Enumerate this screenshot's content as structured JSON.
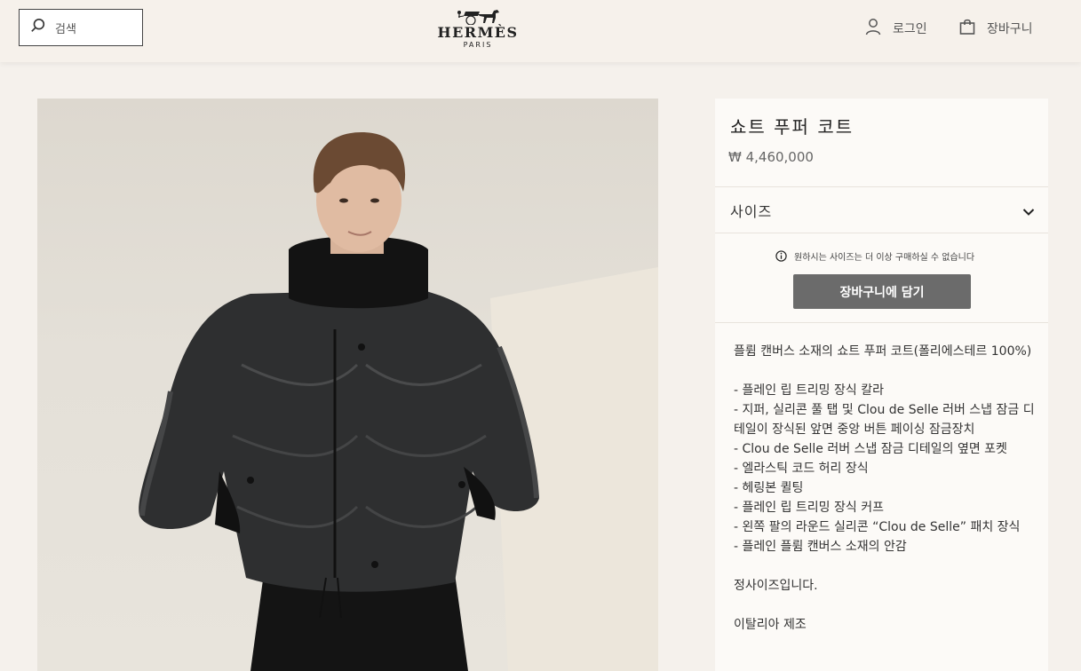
{
  "header": {
    "search_placeholder": "검색",
    "logo_brand": "HERMÈS",
    "logo_city": "PARIS",
    "login_label": "로그인",
    "cart_label": "장바구니"
  },
  "product": {
    "title": "쇼트 푸퍼 코트",
    "price": "₩ 4,460,000",
    "size_label": "사이즈",
    "size_notice": "원하시는 사이즈는 더 이상 구매하실 수 없습니다",
    "add_to_cart_label": "장바구니에 담기",
    "description_intro": "플륌 캔버스 소재의 쇼트 푸퍼 코트(폴리에스테르 100%)",
    "features": [
      "- 플레인 립 트리밍 장식 칼라",
      "- 지퍼, 실리콘 풀 탭 및 Clou de Selle 러버 스냅 잠금 디테일이 장식된 앞면 중앙 버튼 페이싱 잠금장치",
      "- Clou de Selle 러버 스냅 잠금 디테일의 옆면 포켓",
      "- 엘라스틱 코드 허리 장식",
      "- 헤링본 퀼팅",
      "- 플레인 립 트리밍 장식 커프",
      "- 왼쪽 팔의 라운드 실리콘 “Clou de Selle” 패치 장식",
      "- 플레인 플륌 캔버스 소재의 안감"
    ],
    "fit_note": "정사이즈입니다.",
    "origin": "이탈리아 제조"
  },
  "colors": {
    "page_bg": "#f5f1ec",
    "button_bg": "#6b6b6b",
    "panel_bg": "#fcfaf7"
  }
}
